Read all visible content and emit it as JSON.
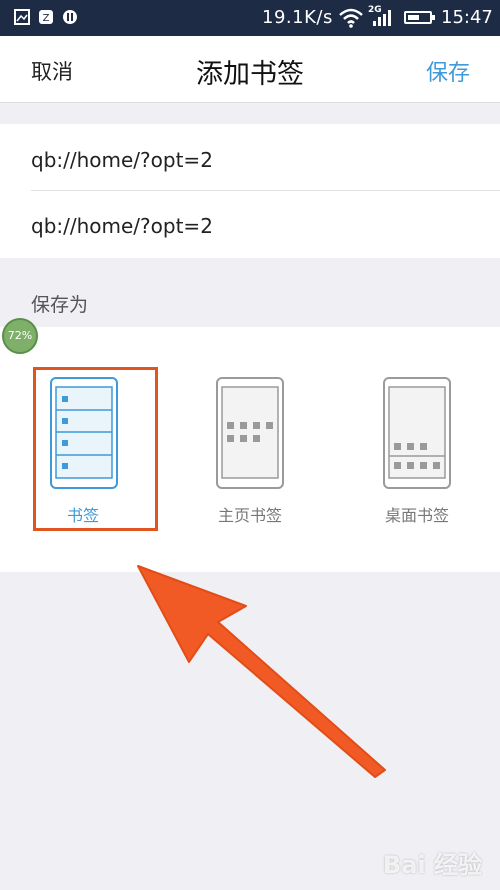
{
  "status_bar": {
    "network_speed": "19.1K/s",
    "network_type": "2G",
    "time": "15:47",
    "battery_level": 0.55
  },
  "header": {
    "cancel_label": "取消",
    "title": "添加书签",
    "save_label": "保存"
  },
  "fields": {
    "title_value": "qb://home/?opt=2",
    "url_value": "qb://home/?opt=2"
  },
  "save_as": {
    "label": "保存为",
    "options": [
      {
        "label": "书签",
        "selected": true,
        "icon": "bookmark-list-icon"
      },
      {
        "label": "主页书签",
        "selected": false,
        "icon": "homepage-grid-icon"
      },
      {
        "label": "桌面书签",
        "selected": false,
        "icon": "desktop-grid-icon"
      }
    ]
  },
  "overlay": {
    "progress_badge": "72%",
    "watermark": "Bai 经验",
    "arrow_color": "#f15a24",
    "highlight_color": "#e0541f"
  },
  "colors": {
    "accent": "#3e9ad9",
    "status_bar_bg": "#1d2b44",
    "page_bg": "#efeff4"
  }
}
